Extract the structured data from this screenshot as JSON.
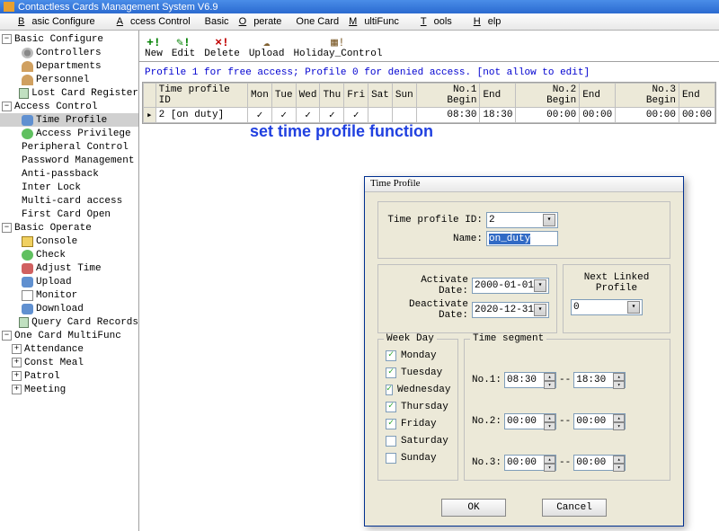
{
  "window": {
    "title": "Contactless Cards Management System  V6.9"
  },
  "menubar": {
    "basic_configure": "Basic Configure",
    "access_control": "Access Control",
    "basic_operate": "Basic Operate",
    "one_card": "One Card MultiFunc",
    "tools": "Tools",
    "help": "Help"
  },
  "tree": {
    "basic_configure": "Basic Configure",
    "controllers": "Controllers",
    "departments": "Departments",
    "personnel": "Personnel",
    "lost_card": "Lost Card Register",
    "access_control": "Access Control",
    "time_profile": "Time Profile",
    "access_priv": "Access Privilege",
    "peripheral": "Peripheral Control",
    "password_mgmt": "Password Management",
    "anti_passback": "Anti-passback",
    "inter_lock": "Inter Lock",
    "multi_card": "Multi-card access",
    "first_card": "First Card Open",
    "basic_operate": "Basic Operate",
    "console": "Console",
    "check": "Check",
    "adjust_time": "Adjust Time",
    "upload": "Upload",
    "monitor": "Monitor",
    "download": "Download",
    "query": "Query Card Records",
    "one_card": "One Card MultiFunc",
    "attendance": "Attendance",
    "const_meal": "Const Meal",
    "patrol": "Patrol",
    "meeting": "Meeting"
  },
  "toolbar": {
    "new": "New",
    "edit": "Edit",
    "delete": "Delete",
    "upload": "Upload",
    "holiday": "Holiday_Control"
  },
  "info_text": "Profile 1 for free access; Profile 0  for denied access.  [not allow to edit]",
  "grid": {
    "headers": {
      "time_profile_id": "Time profile ID",
      "mon": "Mon",
      "tue": "Tue",
      "wed": "Wed",
      "thu": "Thu",
      "fri": "Fri",
      "sat": "Sat",
      "sun": "Sun",
      "no1_begin": "No.1 Begin",
      "end1": "End",
      "no2_begin": "No.2 Begin",
      "end2": "End",
      "no3_begin": "No.3 Begin",
      "end3": "End"
    },
    "row": {
      "id": "2 [on duty]",
      "mon": "✓",
      "tue": "✓",
      "wed": "✓",
      "thu": "✓",
      "fri": "✓",
      "sat": "",
      "sun": "",
      "b1": "08:30",
      "e1": "18:30",
      "b2": "00:00",
      "e2": "00:00",
      "b3": "00:00",
      "e3": "00:00"
    }
  },
  "big_label": "set time profile function",
  "dialog": {
    "title": "Time Profile",
    "labels": {
      "time_profile_id": "Time profile ID:",
      "name": "Name:",
      "activate": "Activate Date:",
      "deactivate": "Deactivate Date:",
      "next_linked": "Next Linked Profile",
      "week_day": "Week Day",
      "time_segment": "Time segment",
      "no1": "No.1:",
      "no2": "No.2:",
      "no3": "No.3:",
      "dash": "--"
    },
    "values": {
      "profile_id": "2",
      "name": "on_duty",
      "activate": "2000-01-01",
      "deactivate": "2020-12-31",
      "next_linked": "0",
      "ts1a": "08:30",
      "ts1b": "18:30",
      "ts2a": "00:00",
      "ts2b": "00:00",
      "ts3a": "00:00",
      "ts3b": "00:00"
    },
    "weekdays": {
      "mon": "Monday",
      "tue": "Tuesday",
      "wed": "Wednesday",
      "thu": "Thursday",
      "fri": "Friday",
      "sat": "Saturday",
      "sun": "Sunday"
    },
    "checked": {
      "mon": true,
      "tue": true,
      "wed": true,
      "thu": true,
      "fri": true,
      "sat": false,
      "sun": false
    },
    "buttons": {
      "ok": "OK",
      "cancel": "Cancel"
    }
  }
}
